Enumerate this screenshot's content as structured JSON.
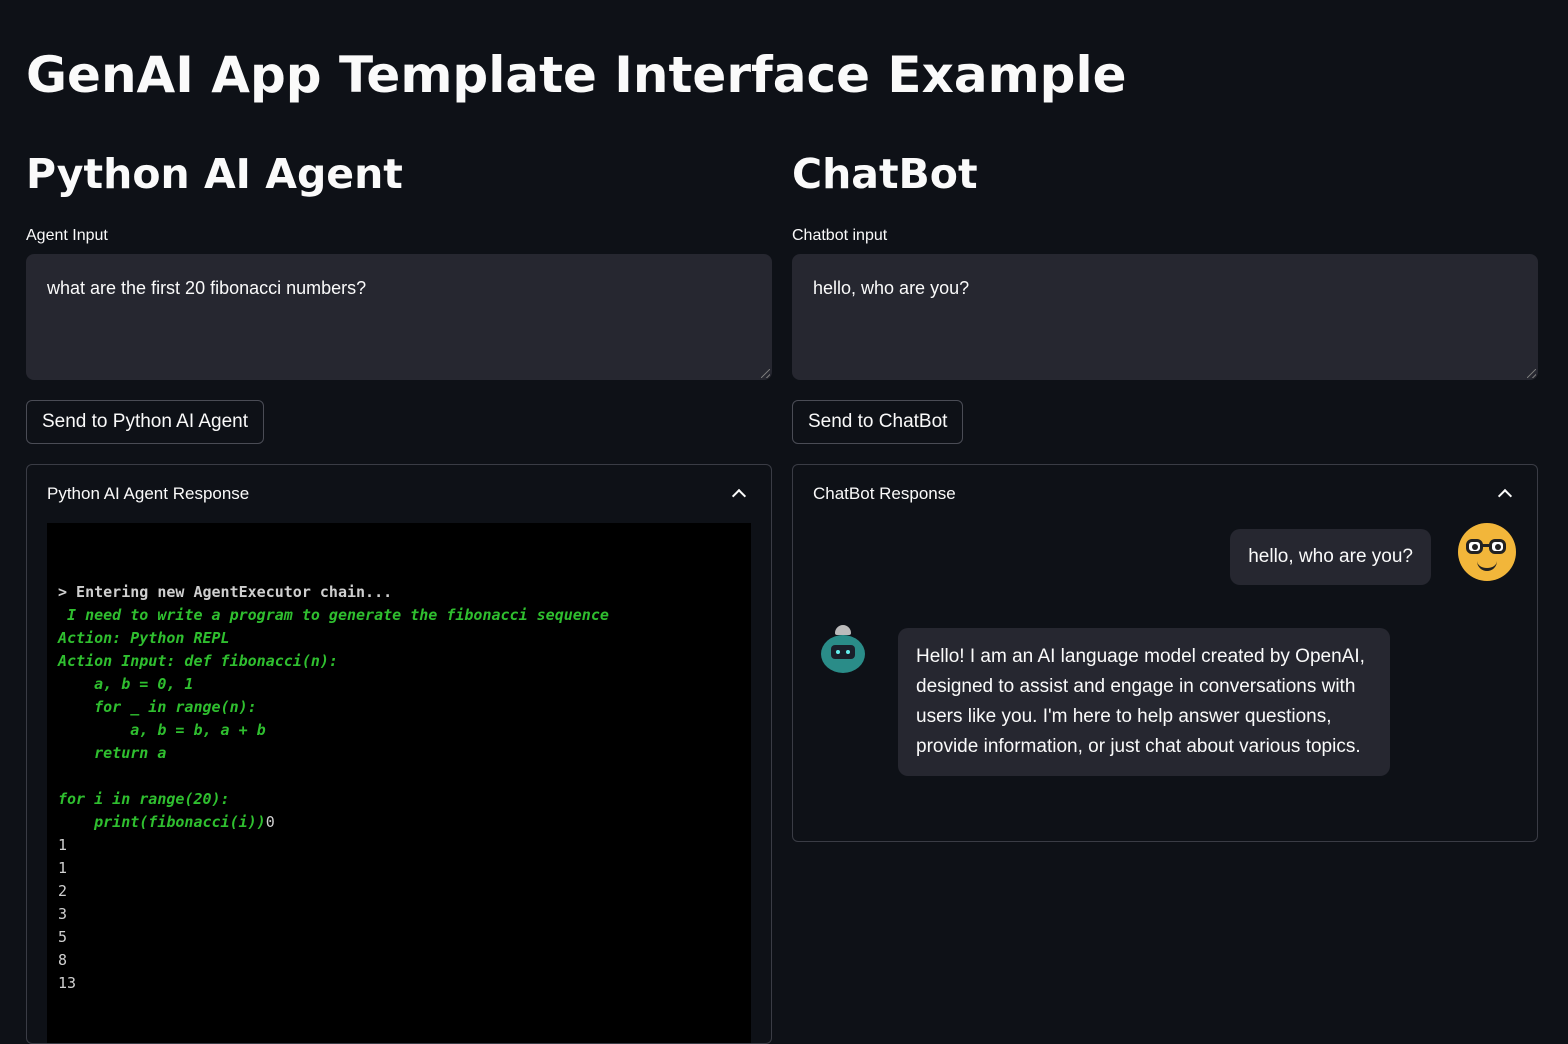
{
  "header": {
    "title": "GenAI App Template Interface Example"
  },
  "agent": {
    "title": "Python AI Agent",
    "input_label": "Agent Input",
    "input_value": "what are the first 20 fibonacci numbers?",
    "button_label": "Send to Python AI Agent",
    "response_title": "Python AI Agent Response",
    "console_lines": [
      {
        "style": "white",
        "text": "> Entering new AgentExecutor chain..."
      },
      {
        "style": "green",
        "text": " I need to write a program to generate the fibonacci sequence"
      },
      {
        "style": "green",
        "text": "Action: Python REPL"
      },
      {
        "style": "green",
        "text": "Action Input: def fibonacci(n):"
      },
      {
        "style": "green",
        "text": "    a, b = 0, 1"
      },
      {
        "style": "green",
        "text": "    for _ in range(n):"
      },
      {
        "style": "green",
        "text": "        a, b = b, a + b"
      },
      {
        "style": "green",
        "text": "    return a"
      },
      {
        "style": "green",
        "text": ""
      },
      {
        "style": "green",
        "text": "for i in range(20):"
      },
      {
        "style": "mixed",
        "text": "    print(fibonacci(i))",
        "tail": "0"
      },
      {
        "style": "plain",
        "text": "1"
      },
      {
        "style": "plain",
        "text": "1"
      },
      {
        "style": "plain",
        "text": "2"
      },
      {
        "style": "plain",
        "text": "3"
      },
      {
        "style": "plain",
        "text": "5"
      },
      {
        "style": "plain",
        "text": "8"
      },
      {
        "style": "plain",
        "text": "13"
      }
    ]
  },
  "chatbot": {
    "title": "ChatBot",
    "input_label": "Chatbot input",
    "input_value": "hello, who are you?",
    "button_label": "Send to ChatBot",
    "response_title": "ChatBot Response",
    "user_message": "hello, who are you?",
    "bot_message": "Hello! I am an AI language model created by OpenAI, designed to assist and engage in conversations with users like you. I'm here to help answer questions, provide information, or just chat about various topics."
  },
  "colors": {
    "background": "#0e1117",
    "input_bg": "#262730",
    "console_green": "#2fbf2f"
  },
  "icons": {
    "collapse": "chevron-up-icon",
    "user_avatar": "nerd-face-icon",
    "bot_avatar": "robot-icon"
  }
}
